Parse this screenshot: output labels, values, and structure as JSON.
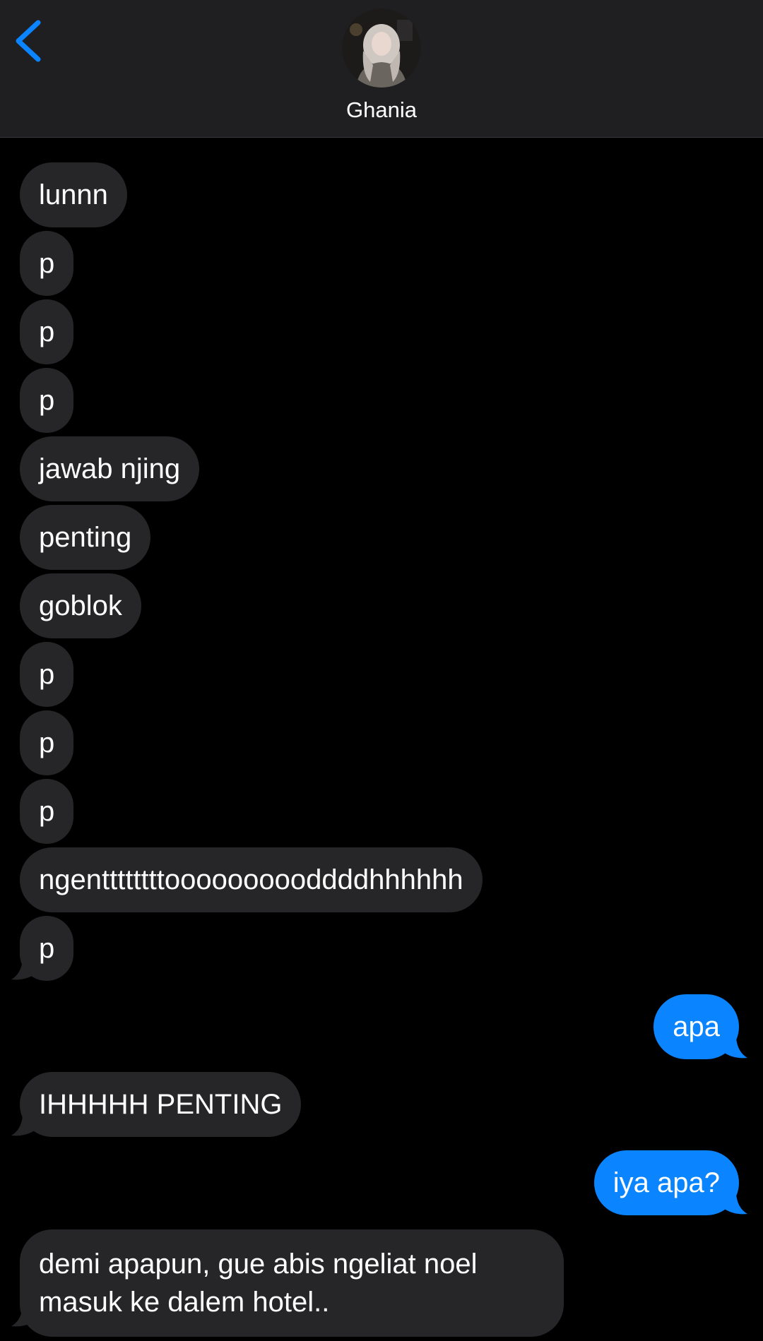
{
  "header": {
    "contact_name": "Ghania"
  },
  "colors": {
    "incoming_bubble": "#262628",
    "outgoing_bubble": "#0a84ff",
    "accent": "#0a84ff",
    "header_bg": "#1f1f21",
    "background": "#000000"
  },
  "messages": [
    {
      "from": "them",
      "text": "lunnn"
    },
    {
      "from": "them",
      "text": "p"
    },
    {
      "from": "them",
      "text": "p"
    },
    {
      "from": "them",
      "text": "p"
    },
    {
      "from": "them",
      "text": "jawab njing"
    },
    {
      "from": "them",
      "text": "penting"
    },
    {
      "from": "them",
      "text": "goblok"
    },
    {
      "from": "them",
      "text": "p"
    },
    {
      "from": "them",
      "text": "p"
    },
    {
      "from": "them",
      "text": "p"
    },
    {
      "from": "them",
      "text": "ngenttttttttoooooooooddddhhhhhh"
    },
    {
      "from": "them",
      "text": "p"
    },
    {
      "from": "me",
      "text": "apa"
    },
    {
      "from": "them",
      "text": "IHHHHH PENTING"
    },
    {
      "from": "me",
      "text": "iya apa?"
    },
    {
      "from": "them",
      "text": "demi apapun, gue abis ngeliat noel masuk ke dalem hotel.."
    }
  ]
}
